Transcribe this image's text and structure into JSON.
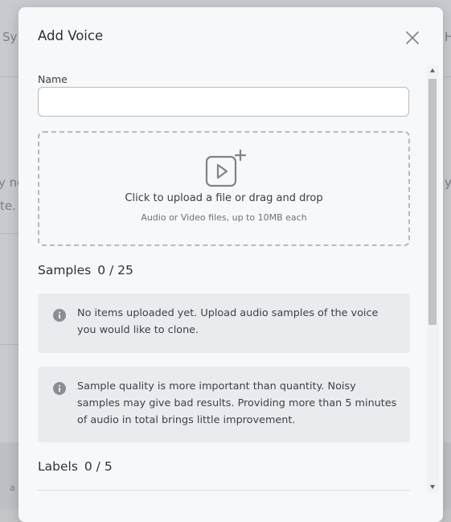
{
  "background": {
    "frag_top_left": "Sy",
    "frag_top_right": "H",
    "frag_mid_left_1": "y no",
    "frag_mid_left_2": "te.",
    "frag_mid_right": "y",
    "frag_bottom_left": "a"
  },
  "modal": {
    "title": "Add Voice",
    "name_label": "Name",
    "name_value": "",
    "upload": {
      "main_text": "Click to upload a file or drag and drop",
      "sub_text": "Audio or Video files, up to 10MB each"
    },
    "samples": {
      "label": "Samples",
      "count": "0 / 25",
      "empty_notice": "No items uploaded yet. Upload audio samples of the voice you would like to clone.",
      "quality_notice": "Sample quality is more important than quantity. Noisy samples may give bad results. Providing more than 5 minutes of audio in total brings little improvement."
    },
    "labels": {
      "label": "Labels",
      "count": "0 / 5"
    }
  },
  "icons": {
    "close": "close-icon",
    "upload": "video-plus-icon",
    "info": "info-icon"
  },
  "colors": {
    "modal_bg": "#f6f8f9",
    "overlay": "#c9cacf",
    "info_bg": "#e9ecef",
    "icon_gray": "#8a8d92"
  }
}
